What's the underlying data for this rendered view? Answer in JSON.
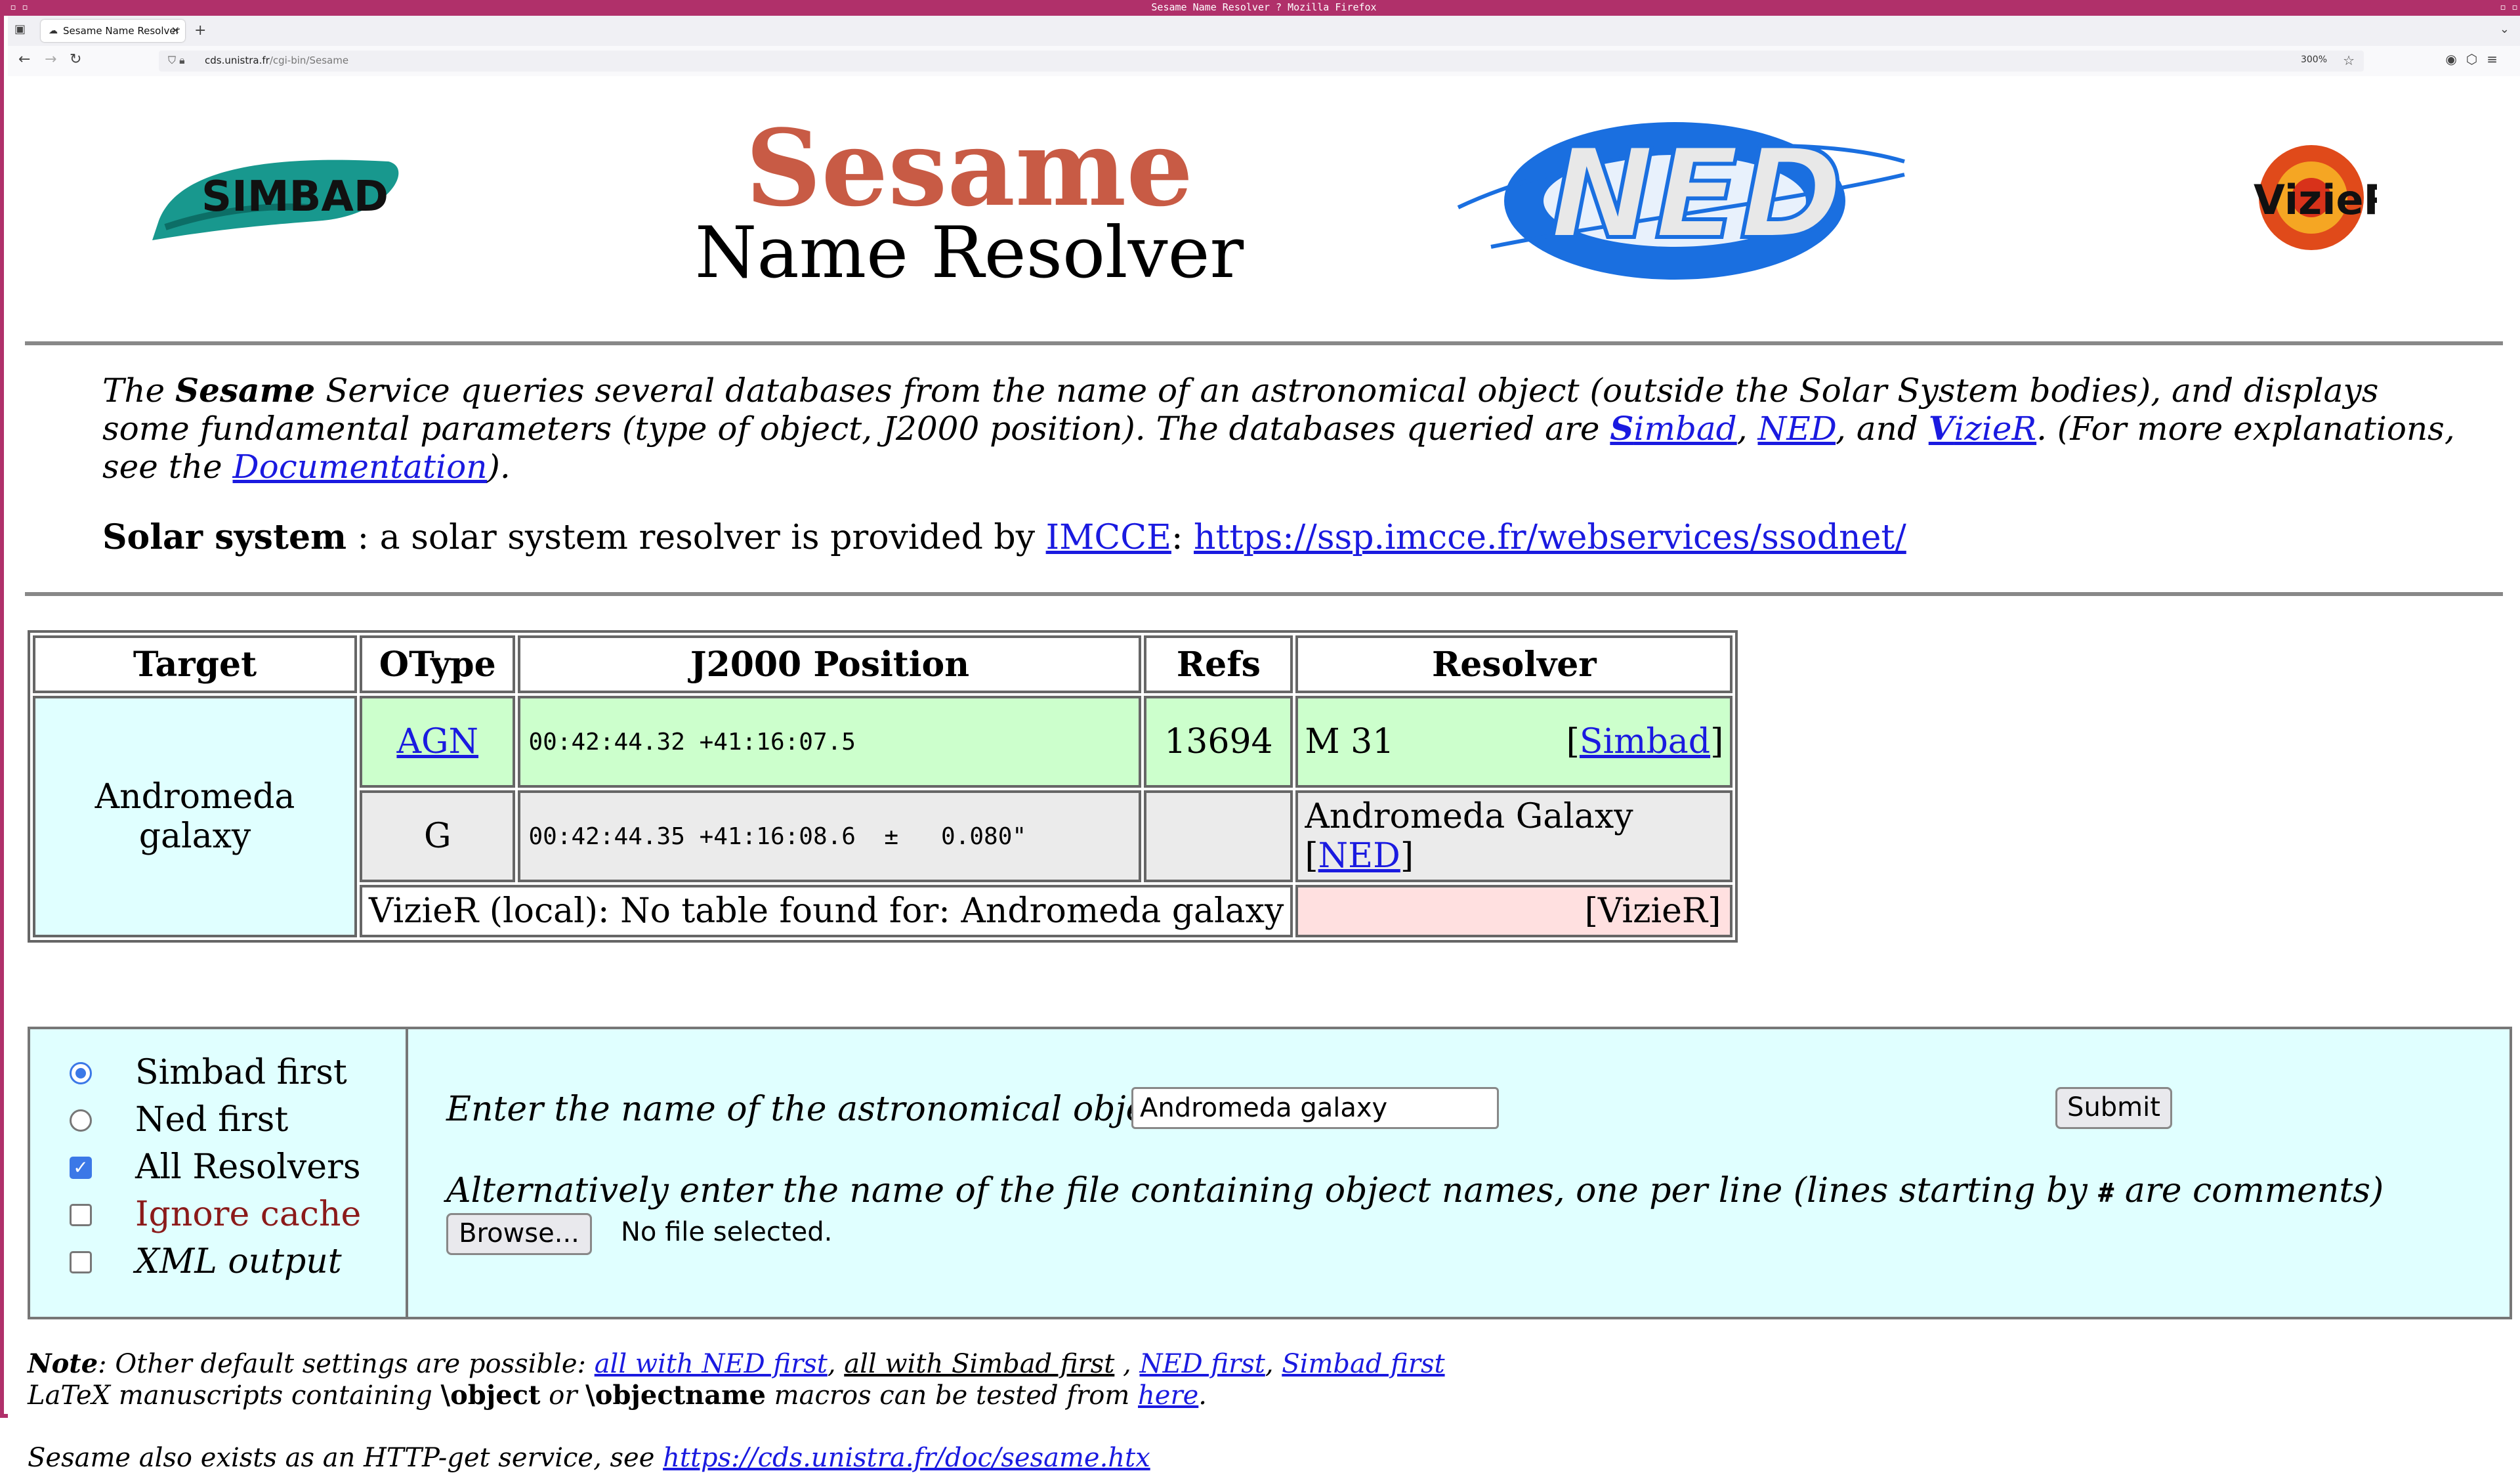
{
  "browser": {
    "window_title": "Sesame Name Resolver ? Mozilla Firefox",
    "tab_title": "Sesame Name Resolver",
    "url_host": "cds.unistra.fr",
    "url_path": "/cgi-bin/Sesame",
    "zoom": "300%"
  },
  "header": {
    "title": "Sesame",
    "subtitle": "Name Resolver",
    "logo_simbad": "SIMBAD",
    "logo_ned": "NED",
    "logo_vizier": "VizieR"
  },
  "intro": {
    "p1": "The ",
    "sesame": "Sesame",
    "p2": " Service queries several databases from the name of an astronomical object (outside the Solar System bodies), and displays some fundamental parameters (type of object, J2000 position). The databases queried are ",
    "simbad_s": "S",
    "simbad_rest": "imbad",
    "comma1": ", ",
    "ned": "NED",
    "and": ", and ",
    "vizier_v": "V",
    "vizier_rest": "izieR",
    "p3": ". (For more explanations, see the ",
    "doc": "Documentation",
    "p4": ")."
  },
  "solar": {
    "label": "Solar system",
    "text": " : a solar system resolver is provided by ",
    "imcce": "IMCCE",
    "colon": ": ",
    "link": "https://ssp.imcce.fr/webservices/ssodnet/"
  },
  "results": {
    "headers": [
      "Target",
      "OType",
      "J2000 Position",
      "Refs",
      "Resolver"
    ],
    "target": "Andromeda galaxy",
    "simbad_row": {
      "otype": "AGN",
      "position": "00:42:44.32 +41:16:07.5",
      "refs": "13694",
      "name": "M 31",
      "resolver": "Simbad"
    },
    "ned_row": {
      "otype": "G",
      "position": "00:42:44.35 +41:16:08.6  ±   0.080\"",
      "refs": "",
      "name": "Andromeda Galaxy",
      "resolver": "NED"
    },
    "vizier_row": {
      "message": "VizieR (local): No table found for: Andromeda galaxy",
      "resolver": "[VizieR]"
    }
  },
  "form": {
    "options": {
      "simbad_first": "Simbad first",
      "ned_first": "Ned first",
      "all_resolvers": "All Resolvers",
      "ignore_cache": "Ignore cache",
      "xml_output": "XML output"
    },
    "enter_label": "Enter the name of the astronomical object",
    "object_value": "Andromeda galaxy",
    "submit": "Submit",
    "alt_label_1": "Alternatively enter the name of the file containing object names, one per line (lines starting by ",
    "alt_hash": "#",
    "alt_label_2": " are comments)",
    "browse": "Browse...",
    "no_file": "No file selected."
  },
  "note": {
    "label": "Note",
    "text": ": Other default settings are possible: ",
    "link1": "all with NED first",
    "sep1": ", ",
    "link2": "all with Simbad first",
    "sep2": " , ",
    "link3": "NED first",
    "sep3": ", ",
    "link4": "Simbad first",
    "latex1": "LaTeX manuscripts containing ",
    "obj": "\\object",
    "or": " or ",
    "objname": "\\objectname",
    "latex2": " macros can be tested from ",
    "here": "here",
    "dot": "."
  },
  "http": {
    "text": "Sesame also exists as an HTTP-get service, see ",
    "link": "https://cds.unistra.fr/doc/sesame.htx"
  },
  "colors": {
    "title": "#c85b45",
    "link": "#1a1ae0",
    "window_border": "#b0306a",
    "simbad_row": "#ccffcc",
    "ned_row": "#ebebeb",
    "target_cell": "#e0ffff",
    "vizier_cell": "#ffe0e0"
  }
}
